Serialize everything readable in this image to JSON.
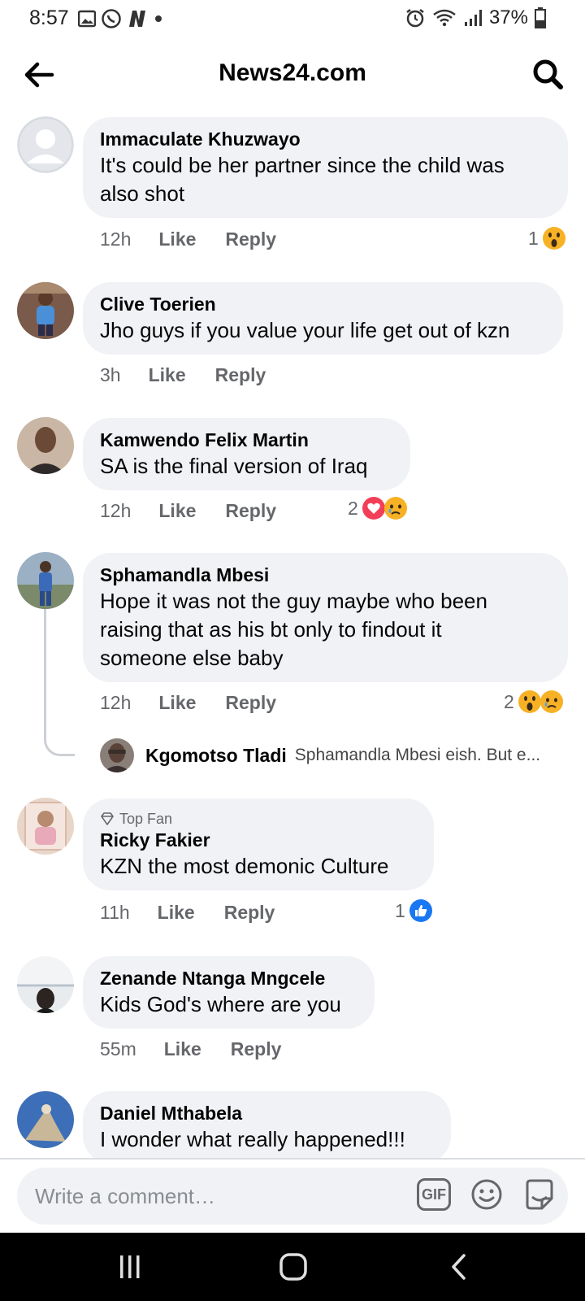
{
  "status_bar": {
    "time": "8:57",
    "battery": "37%"
  },
  "header": {
    "title": "News24.com"
  },
  "comments": [
    {
      "author": "Immaculate Khuzwayo",
      "text": [
        "It's could be her partner since the child was",
        "also shot"
      ],
      "time": "12h",
      "like": "Like",
      "reply": "Reply",
      "reaction_count": "1",
      "reactions": [
        "wow"
      ]
    },
    {
      "author": "Clive Toerien",
      "text": [
        "Jho guys if you value your life get out of kzn"
      ],
      "time": "3h",
      "like": "Like",
      "reply": "Reply"
    },
    {
      "author": "Kamwendo Felix Martin",
      "text": [
        "SA is the final version of Iraq"
      ],
      "time": "12h",
      "like": "Like",
      "reply": "Reply",
      "reaction_count": "2",
      "reactions": [
        "love",
        "sad"
      ]
    },
    {
      "author": "Sphamandla Mbesi",
      "text": [
        "Hope it was not the guy maybe who been",
        "raising that as his bt only to findout it",
        "someone else baby"
      ],
      "time": "12h",
      "like": "Like",
      "reply": "Reply",
      "reaction_count": "2",
      "reactions": [
        "wow",
        "sad"
      ],
      "reply_preview": {
        "author": "Kgomotso Tladi",
        "text": "Sphamandla Mbesi  eish. But e..."
      }
    },
    {
      "badge": "Top Fan",
      "author": "Ricky Fakier",
      "text": [
        "KZN the most demonic Culture"
      ],
      "time": "11h",
      "like": "Like",
      "reply": "Reply",
      "reaction_count": "1",
      "reactions": [
        "like"
      ]
    },
    {
      "author": "Zenande Ntanga Mngcele",
      "text": [
        "Kids God's where are you"
      ],
      "time": "55m",
      "like": "Like",
      "reply": "Reply"
    },
    {
      "author": "Daniel Mthabela",
      "text": [
        "I wonder what really happened!!!"
      ]
    }
  ],
  "composer": {
    "placeholder": "Write a comment…",
    "gif_label": "GIF"
  },
  "icons": {
    "back": "arrow-left-icon",
    "search": "search-icon",
    "gif": "gif-icon",
    "emoji": "emoji-icon",
    "sticker": "sticker-icon",
    "nav_recents": "recents-icon",
    "nav_home": "home-icon",
    "nav_back": "nav-back-icon"
  },
  "colors": {
    "bubble": "#f0f2f5",
    "meta": "#65676b",
    "love": "#f33e58",
    "like": "#1877f2",
    "emoji": "#f7b125"
  }
}
